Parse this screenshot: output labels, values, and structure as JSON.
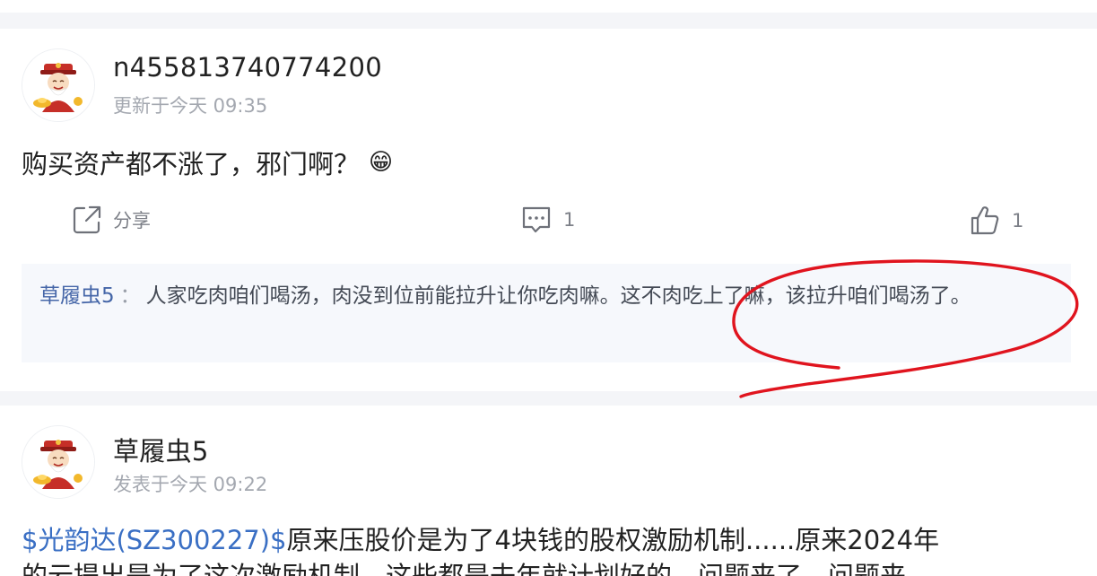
{
  "post1": {
    "username": "n455813740774200",
    "meta": "更新于今天 09:35",
    "content": "购买资产都不涨了，邪门啊？",
    "emoji": "😁",
    "actions": {
      "share_label": "分享",
      "comment_count": "1",
      "like_count": "1"
    },
    "reply": {
      "author": "草履虫5",
      "colon": "：",
      "text": "人家吃肉咱们喝汤，肉没到位前能拉升让你吃肉嘛。这不肉吃上了嘛，该拉升咱们喝汤了。"
    }
  },
  "post2": {
    "username": "草履虫5",
    "meta": "发表于今天 09:22",
    "stock_link": "$光韵达(SZ300227)$",
    "content_line1": "原来压股价是为了4块钱的股权激励机制......原来2024年",
    "content_line2": "的云提出是为了这次激励机制，这些都是去年就计划好的，问题来了，问题来"
  },
  "annotation": {
    "color": "#e0141e",
    "shape": "red hand-drawn ellipse"
  }
}
